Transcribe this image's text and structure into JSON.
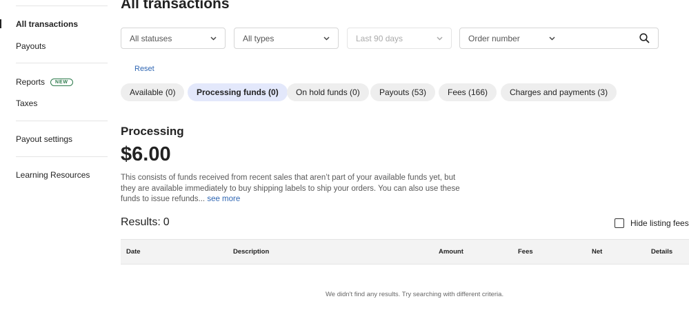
{
  "sidebar": {
    "items": [
      {
        "label": "All transactions",
        "active": true
      },
      {
        "label": "Payouts"
      },
      {
        "label": "Reports",
        "badge": "NEW"
      },
      {
        "label": "Taxes"
      },
      {
        "label": "Payout settings"
      },
      {
        "label": "Learning Resources"
      }
    ]
  },
  "header": {
    "title": "All transactions"
  },
  "filters": {
    "status": "All statuses",
    "type": "All types",
    "date_range": "Last 90 days",
    "search_field": "Order number",
    "search_value": "",
    "reset_label": "Reset"
  },
  "tabs": [
    {
      "label": "Available (0)"
    },
    {
      "label": "Processing funds (0)",
      "active": true
    },
    {
      "label": "On hold funds (0)"
    },
    {
      "label": "Payouts (53)"
    },
    {
      "label": "Fees (166)"
    },
    {
      "label": "Charges and payments (3)"
    }
  ],
  "processing": {
    "title": "Processing",
    "amount": "$6.00",
    "description": "This consists of funds received from recent sales that aren’t part of your available funds yet, but they are available immediately to buy shipping labels to ship your orders. You can also use these funds to issue refunds...",
    "see_more": "see more"
  },
  "results": {
    "label": "Results:",
    "count": "0",
    "hide_fees_label": "Hide listing fees",
    "hide_fees_checked": false
  },
  "table": {
    "columns": [
      "Date",
      "Description",
      "Amount",
      "Fees",
      "Net",
      "Details"
    ],
    "empty_message": "We didn't find any results. Try searching with different criteria."
  },
  "colors": {
    "accent_link": "#2f66b3",
    "active_pill": "#e3e8fb",
    "badge_green": "#2c7a4b"
  },
  "icons": {
    "dropdown": "chevron-down-icon",
    "search": "search-icon"
  }
}
